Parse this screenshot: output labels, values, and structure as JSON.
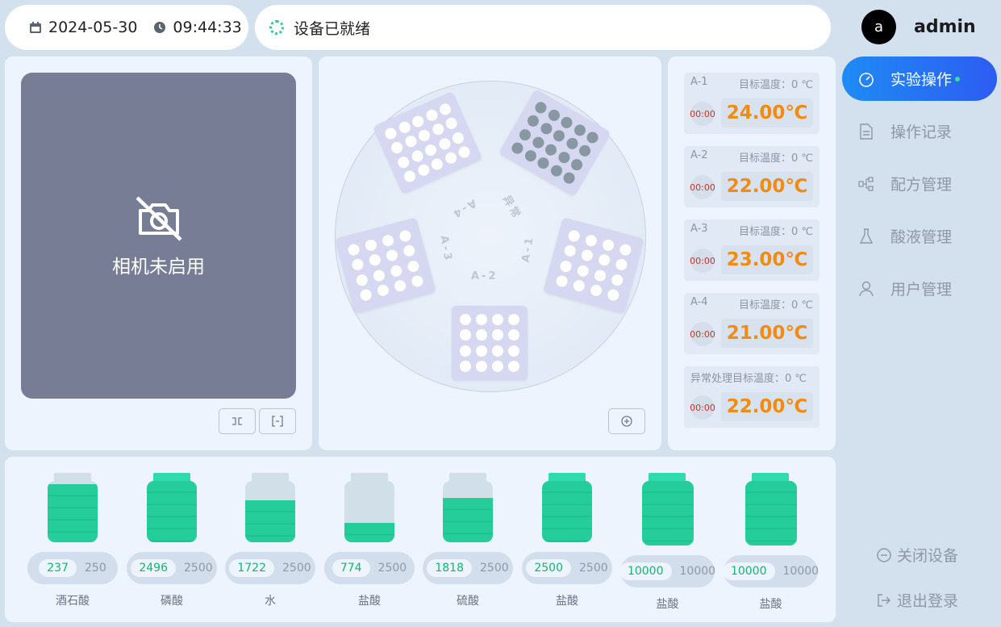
{
  "header": {
    "date": "2024-05-30",
    "time": "09:44:33",
    "status": "设备已就绪"
  },
  "user": {
    "avatar_letter": "a",
    "name": "admin"
  },
  "camera": {
    "status_label": "相机未启用"
  },
  "tray": {
    "slot_labels": [
      "A-1",
      "A-2",
      "A-3",
      "A-4",
      "异常"
    ]
  },
  "temps": [
    {
      "name": "A-1",
      "target": "目标温度：0 ℃",
      "timer": "00:00",
      "value": "24.00℃"
    },
    {
      "name": "A-2",
      "target": "目标温度：0 ℃",
      "timer": "00:00",
      "value": "22.00℃"
    },
    {
      "name": "A-3",
      "target": "目标温度：0 ℃",
      "timer": "00:00",
      "value": "23.00℃"
    },
    {
      "name": "A-4",
      "target": "目标温度：0 ℃",
      "timer": "00:00",
      "value": "21.00℃"
    },
    {
      "name": "异常处理",
      "target": "目标温度：0 ℃",
      "timer": "00:00",
      "value": "22.00℃"
    }
  ],
  "nav": {
    "items": [
      {
        "label": "实验操作",
        "icon": "gauge-icon",
        "active": true
      },
      {
        "label": "操作记录",
        "icon": "document-icon",
        "active": false
      },
      {
        "label": "配方管理",
        "icon": "flowchart-icon",
        "active": false
      },
      {
        "label": "酸液管理",
        "icon": "flask-icon",
        "active": false
      },
      {
        "label": "用户管理",
        "icon": "user-icon",
        "active": false
      }
    ],
    "shutdown_label": "关闭设备",
    "logout_label": "退出登录"
  },
  "reagents": [
    {
      "name": "酒石酸",
      "current": "237",
      "capacity": "250",
      "fill": 0.948
    },
    {
      "name": "磷酸",
      "current": "2496",
      "capacity": "2500",
      "fill": 0.998
    },
    {
      "name": "水",
      "current": "1722",
      "capacity": "2500",
      "fill": 0.689
    },
    {
      "name": "盐酸",
      "current": "774",
      "capacity": "2500",
      "fill": 0.31
    },
    {
      "name": "硫酸",
      "current": "1818",
      "capacity": "2500",
      "fill": 0.727
    },
    {
      "name": "盐酸",
      "current": "2500",
      "capacity": "2500",
      "fill": 1.0
    },
    {
      "name": "盐酸",
      "current": "10000",
      "capacity": "10000",
      "fill": 1.0
    },
    {
      "name": "盐酸",
      "current": "10000",
      "capacity": "10000",
      "fill": 1.0
    }
  ],
  "colors": {
    "accent": "#2d6ef5",
    "temp": "#f28b14",
    "liquid": "#25cd9a",
    "camera_bg": "#777d95"
  }
}
